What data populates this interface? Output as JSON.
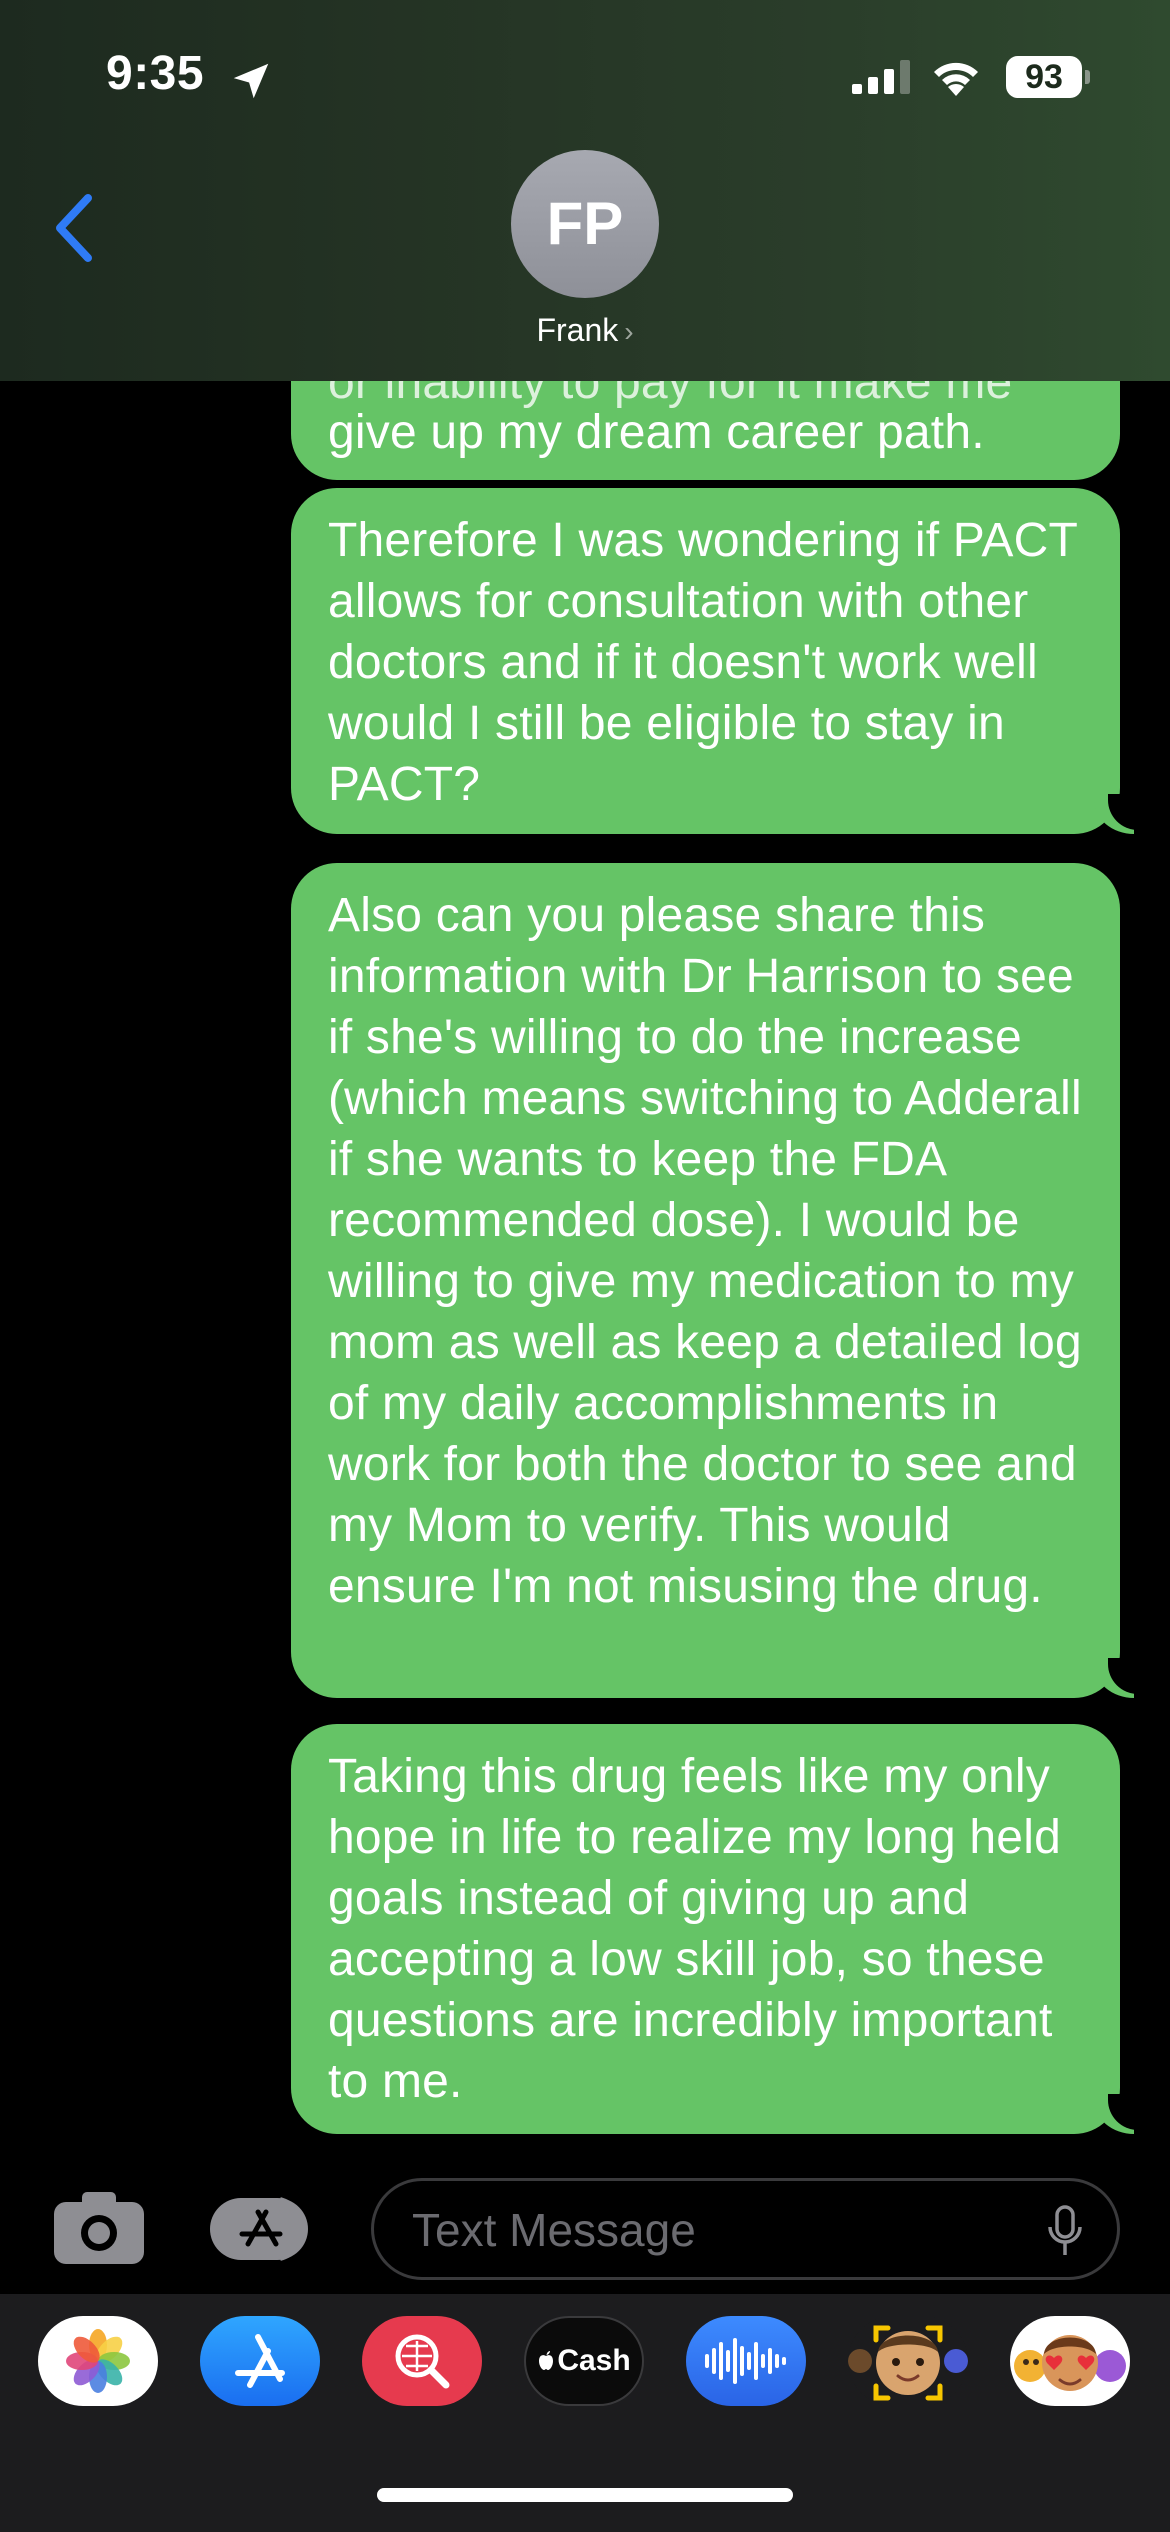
{
  "status_bar": {
    "time": "9:35",
    "battery": "93"
  },
  "header": {
    "back_icon": "chevron-left-icon",
    "avatar_initials": "FP",
    "contact_name": "Frank",
    "name_chevron": "›"
  },
  "messages": [
    {
      "sender": "me",
      "text": "give up my dream career path.",
      "clipped_partial_text": "or inability to pay for it make me"
    },
    {
      "sender": "me",
      "text": "Therefore I was wondering if PACT allows for consultation with other doctors and if it doesn't work well would I still be eligible to stay in PACT?"
    },
    {
      "sender": "me",
      "text": "Also can you please share this information with Dr Harrison to see if she's willing to do the increase (which means switching to Adderall if she wants to keep the FDA recommended dose). I would be willing to give my medication to my mom as well as keep a detailed log of my daily accomplishments in work for both the doctor to see and my Mom to verify. This would ensure I'm not misusing the drug."
    },
    {
      "sender": "me",
      "text": "Taking this drug feels like my only hope in life to realize my long held goals instead of giving up and accepting a low skill job, so these questions are incredibly important to me."
    }
  ],
  "input_bar": {
    "placeholder": "Text Message",
    "camera_icon": "camera-icon",
    "apps_icon": "app-store-icon",
    "mic_icon": "microphone-icon"
  },
  "app_drawer": {
    "apps": [
      {
        "name": "Photos",
        "icon": "photos-icon"
      },
      {
        "name": "App Store",
        "icon": "app-store-icon"
      },
      {
        "name": "Search Images",
        "icon": "image-search-icon"
      },
      {
        "name": "Apple Cash",
        "label": "Cash",
        "icon": "apple-cash-icon"
      },
      {
        "name": "Audio Message",
        "icon": "waveform-icon"
      },
      {
        "name": "Memoji",
        "icon": "memoji-icon"
      },
      {
        "name": "Memoji Stickers",
        "icon": "memoji-stickers-icon"
      }
    ]
  },
  "colors": {
    "bubble_green": "#65c466",
    "accent_blue": "#2f7bf6",
    "background": "#000000"
  }
}
